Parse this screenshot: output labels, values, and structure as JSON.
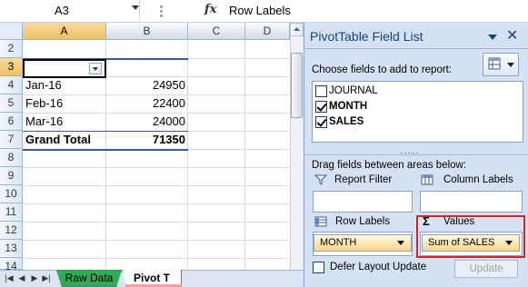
{
  "formula_bar": {
    "name_box": "A3",
    "fx_icon": "fx",
    "formula": "Row Labels"
  },
  "sheet": {
    "columns": [
      "A",
      "B",
      "C",
      "D"
    ],
    "rows": [
      "2",
      "3",
      "4",
      "5",
      "6",
      "7",
      "8",
      "9",
      "10",
      "11",
      "12",
      "13",
      "14"
    ],
    "cells": {
      "a4": "Jan-16",
      "b4": "24950",
      "a5": "Feb-16",
      "b5": "22400",
      "a6": "Mar-16",
      "b6": "24000",
      "a7": "Grand Total",
      "b7": "71350"
    },
    "tabs": [
      "Raw Data",
      "Pivot T"
    ]
  },
  "panel": {
    "title": "PivotTable Field List",
    "choose_label": "Choose fields to add to report:",
    "fields": [
      {
        "label": "JOURNAL",
        "checked": false
      },
      {
        "label": "MONTH",
        "checked": true
      },
      {
        "label": "SALES",
        "checked": true
      }
    ],
    "drag_label": "Drag fields between areas below:",
    "areas": {
      "report_filter": "Report Filter",
      "column_labels": "Column Labels",
      "row_labels": "Row Labels",
      "values": "Values",
      "values_symbol": "Σ"
    },
    "row_field": "MONTH",
    "value_field": "Sum of SALES",
    "defer_label": "Defer Layout Update",
    "update_label": "Update"
  },
  "colors": {
    "highlight": "#e02020",
    "active_tab_stripe": "#f0a0a0",
    "raw_tab": "#2faa55"
  }
}
